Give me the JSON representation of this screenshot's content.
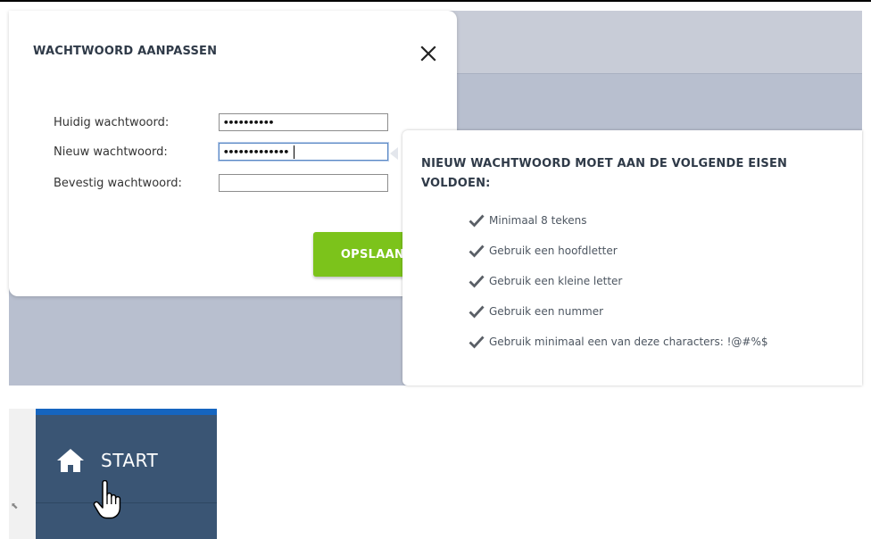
{
  "dialog": {
    "title": "WACHTWOORD AANPASSEN",
    "fields": [
      {
        "label": "Huidig wachtwoord:",
        "value": "••••••••••"
      },
      {
        "label": "Nieuw wachtwoord:",
        "value": "•••••••••••••"
      },
      {
        "label": "Bevestig wachtwoord:",
        "value": ""
      }
    ],
    "save_label": "OPSLAAN"
  },
  "requirements": {
    "title": "NIEUW WACHTWOORD MOET AAN DE VOLGENDE EISEN VOLDOEN:",
    "items": [
      "Minimaal 8 tekens",
      "Gebruik een hoofdletter",
      "Gebruik een kleine letter",
      "Gebruik een nummer",
      "Gebruik minimaal een van deze characters: !@#%$"
    ]
  },
  "nav": {
    "start_label": "START"
  },
  "colors": {
    "accent_green": "#7cc31b",
    "nav_bg": "#3a5574",
    "nav_topbar": "#1565c0"
  }
}
